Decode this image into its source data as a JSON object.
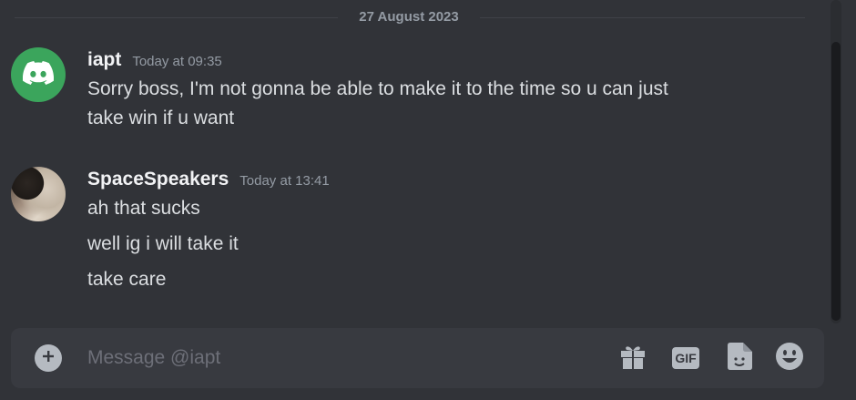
{
  "date_divider": "27 August 2023",
  "messages": [
    {
      "username": "iapt",
      "timestamp": "Today at 09:35",
      "lines": [
        "Sorry boss, I'm not gonna be able to make it to the time so u can just",
        "take win if u want"
      ],
      "avatar_icon": "discord-logo-icon",
      "avatar_color": "#3ba55c"
    },
    {
      "username": "SpaceSpeakers",
      "timestamp": "Today at 13:41",
      "lines": [
        "ah that sucks",
        "well ig i will take it",
        "take care"
      ],
      "avatar_icon": "cat-photo-avatar"
    }
  ],
  "composer": {
    "placeholder": "Message @iapt",
    "gif_label": "GIF",
    "icons": [
      "add-icon",
      "gift-icon",
      "gif-icon",
      "sticker-icon",
      "emoji-icon"
    ]
  },
  "colors": {
    "background": "#313338",
    "composer_bg": "#383a40",
    "username": "#f2f3f5",
    "message_text": "#dbdee1",
    "muted": "#949ba4",
    "icon": "#b5bac1"
  }
}
